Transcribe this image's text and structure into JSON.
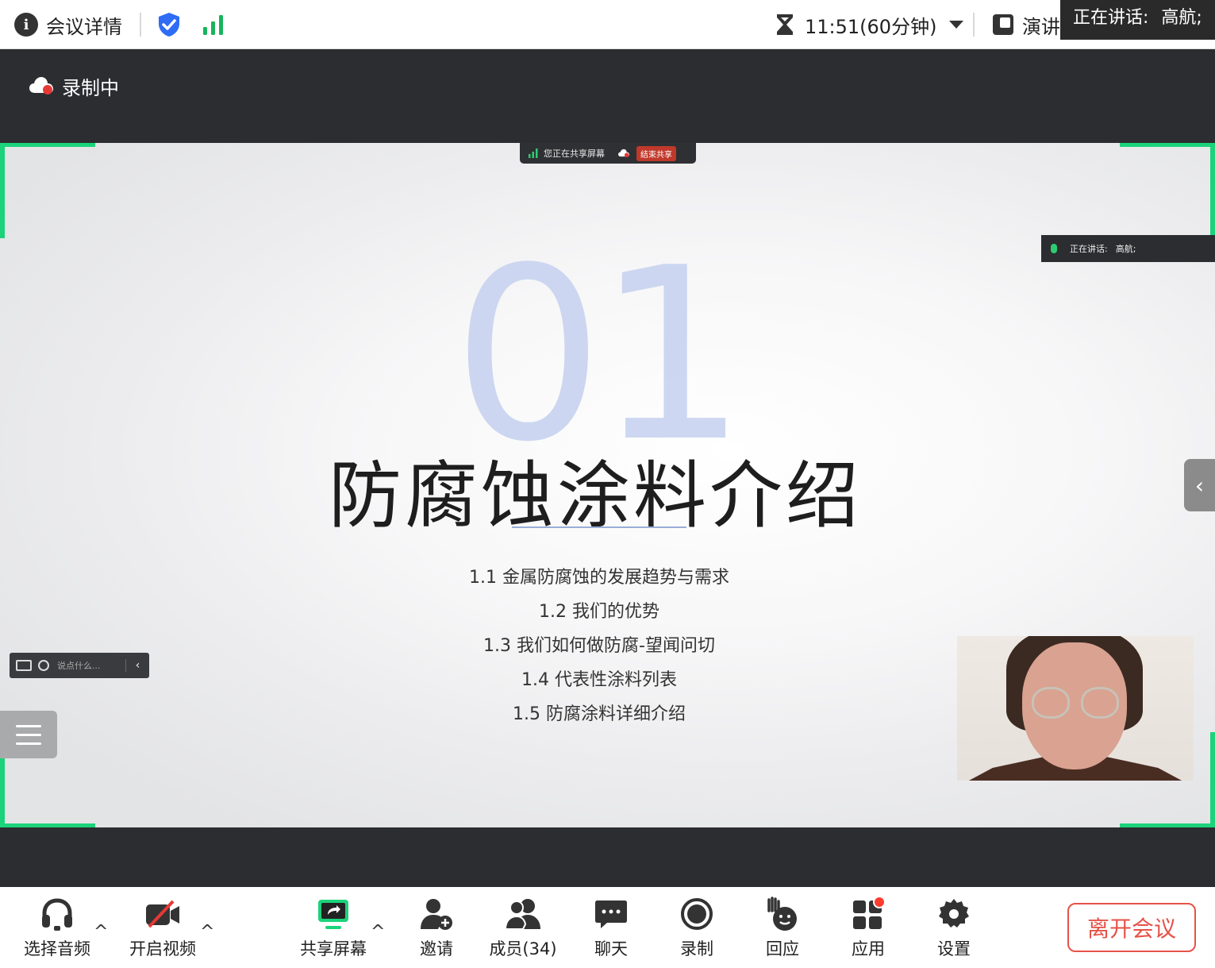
{
  "topbar": {
    "meeting_details": "会议详情",
    "timer": "11:51(60分钟)",
    "speaker_view": "演讲",
    "speaking_prefix": "正在讲话:",
    "speaking_name": "高航;"
  },
  "recording": {
    "label": "录制中"
  },
  "share": {
    "status": "您正在共享屏幕",
    "end_label": "结束共享"
  },
  "slide": {
    "number": "01",
    "title": "防腐蚀涂料介绍",
    "toc": [
      "1.1 金属防腐蚀的发展趋势与需求",
      "1.2 我们的优势",
      "1.3 我们如何做防腐-望闻问切",
      "1.4 代表性涂料列表",
      "1.5 防腐涂料详细介绍"
    ]
  },
  "talking_box": {
    "prefix": "正在讲话:",
    "name": "高航;"
  },
  "chat": {
    "placeholder": "说点什么..."
  },
  "toolbar": {
    "audio": "选择音频",
    "video": "开启视频",
    "share": "共享屏幕",
    "invite": "邀请",
    "members": "成员(34)",
    "chat": "聊天",
    "record": "录制",
    "react": "回应",
    "apps": "应用",
    "settings": "设置",
    "leave": "离开会议"
  },
  "colors": {
    "accent_green": "#1bd37a",
    "leave_red": "#e55248",
    "shield_blue": "#2e6cf6",
    "signal_green": "#18b35c"
  }
}
